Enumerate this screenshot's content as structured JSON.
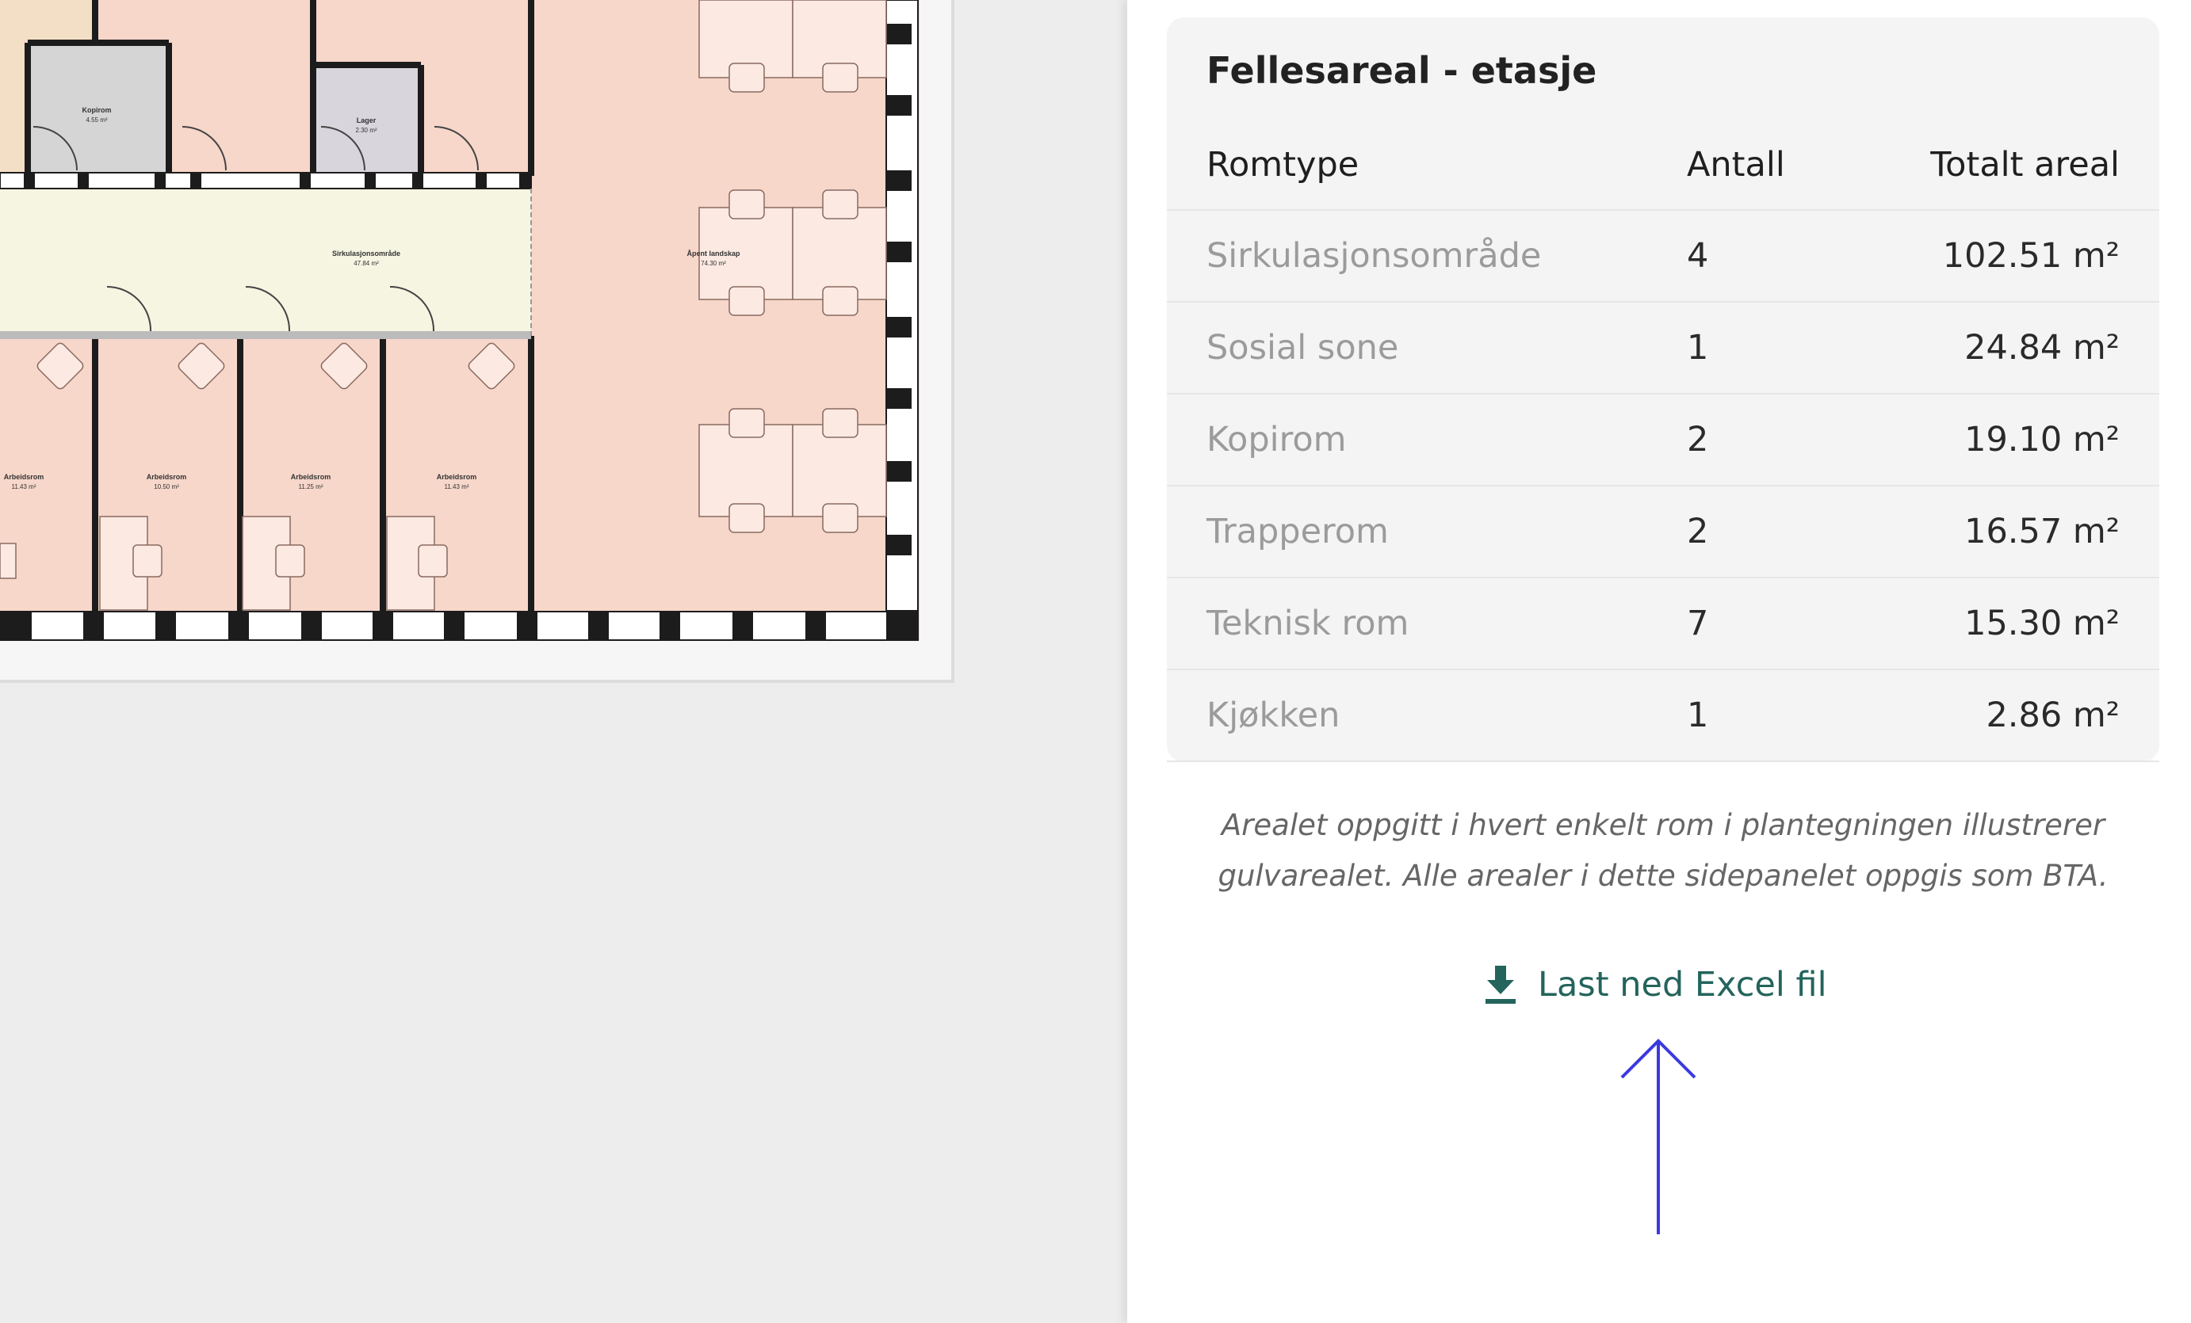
{
  "floorplan": {
    "rooms": [
      {
        "name": "Kopirom",
        "area": "4.55 m²"
      },
      {
        "name": "Lager",
        "area": "2.30 m²"
      },
      {
        "name": "Sirkulasjonsområde",
        "area": "47.84 m²"
      },
      {
        "name": "Åpent landskap",
        "area": "74.30 m²"
      },
      {
        "name": "Arbeidsrom",
        "area": "11.43 m²"
      },
      {
        "name": "Arbeidsrom",
        "area": "10.50 m²"
      },
      {
        "name": "Arbeidsrom",
        "area": "11.25 m²"
      },
      {
        "name": "Arbeidsrom",
        "area": "11.43 m²"
      }
    ]
  },
  "panel": {
    "title": "Fellesareal - etasje",
    "columns": {
      "type": "Romtype",
      "count": "Antall",
      "area": "Totalt areal"
    },
    "rows": [
      {
        "type": "Sirkulasjonsområde",
        "count": "4",
        "area": "102.51 m²"
      },
      {
        "type": "Sosial sone",
        "count": "1",
        "area": "24.84 m²"
      },
      {
        "type": "Kopirom",
        "count": "2",
        "area": "19.10 m²"
      },
      {
        "type": "Trapperom",
        "count": "2",
        "area": "16.57 m²"
      },
      {
        "type": "Teknisk rom",
        "count": "7",
        "area": "15.30 m²"
      },
      {
        "type": "Kjøkken",
        "count": "1",
        "area": "2.86 m²"
      }
    ],
    "note": "Arealet oppgitt i hvert enkelt rom i plantegningen illustrerer gulvarealet. Alle arealer i dette sidepanelet oppgis som BTA.",
    "download_label": "Last ned Excel fil",
    "download_icon": "download-icon",
    "accent_color": "#23645c",
    "annotation_color": "#3a3ae0"
  }
}
